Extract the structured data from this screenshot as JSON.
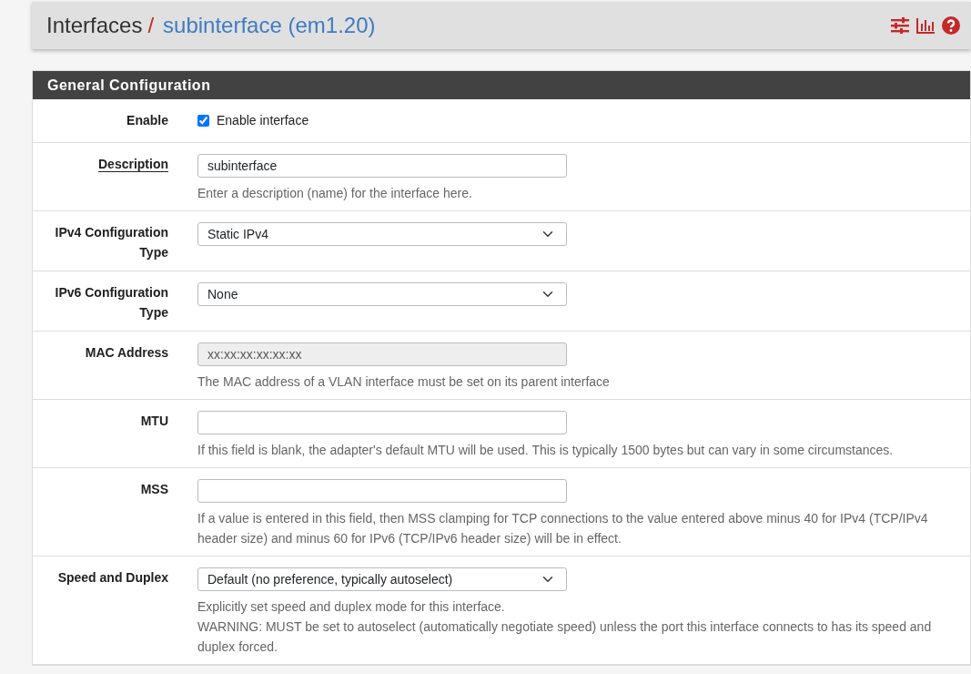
{
  "breadcrumb": {
    "parent": "Interfaces",
    "separator": "/",
    "current": "subinterface (em1.20)"
  },
  "panel": {
    "title": "General Configuration",
    "rows": [
      {
        "label": "Enable",
        "kind": "checkbox",
        "checked": true,
        "option_label": "Enable interface"
      },
      {
        "label": "Description",
        "underlined": true,
        "kind": "text",
        "value": "subinterface",
        "help": [
          "Enter a description (name) for the interface here."
        ]
      },
      {
        "label": "IPv4 Configuration Type",
        "kind": "select",
        "value": "Static IPv4"
      },
      {
        "label": "IPv6 Configuration Type",
        "kind": "select",
        "value": "None"
      },
      {
        "label": "MAC Address",
        "kind": "text",
        "disabled": true,
        "placeholder": "xx:xx:xx:xx:xx:xx",
        "help": [
          "The MAC address of a VLAN interface must be set on its parent interface"
        ]
      },
      {
        "label": "MTU",
        "kind": "text",
        "help": [
          "If this field is blank, the adapter's default MTU will be used. This is typically 1500 bytes but can vary in some circumstances."
        ]
      },
      {
        "label": "MSS",
        "kind": "text",
        "help": [
          "If a value is entered in this field, then MSS clamping for TCP connections to the value entered above minus 40 for IPv4 (TCP/IPv4 header size) and minus 60 for IPv6 (TCP/IPv6 header size) will be in effect."
        ]
      },
      {
        "label": "Speed and Duplex",
        "kind": "select",
        "value": "Default (no preference, typically autoselect)",
        "help": [
          "Explicitly set speed and duplex mode for this interface.",
          "WARNING: MUST be set to autoselect (automatically negotiate speed) unless the port this interface connects to has its speed and duplex forced."
        ]
      }
    ]
  }
}
